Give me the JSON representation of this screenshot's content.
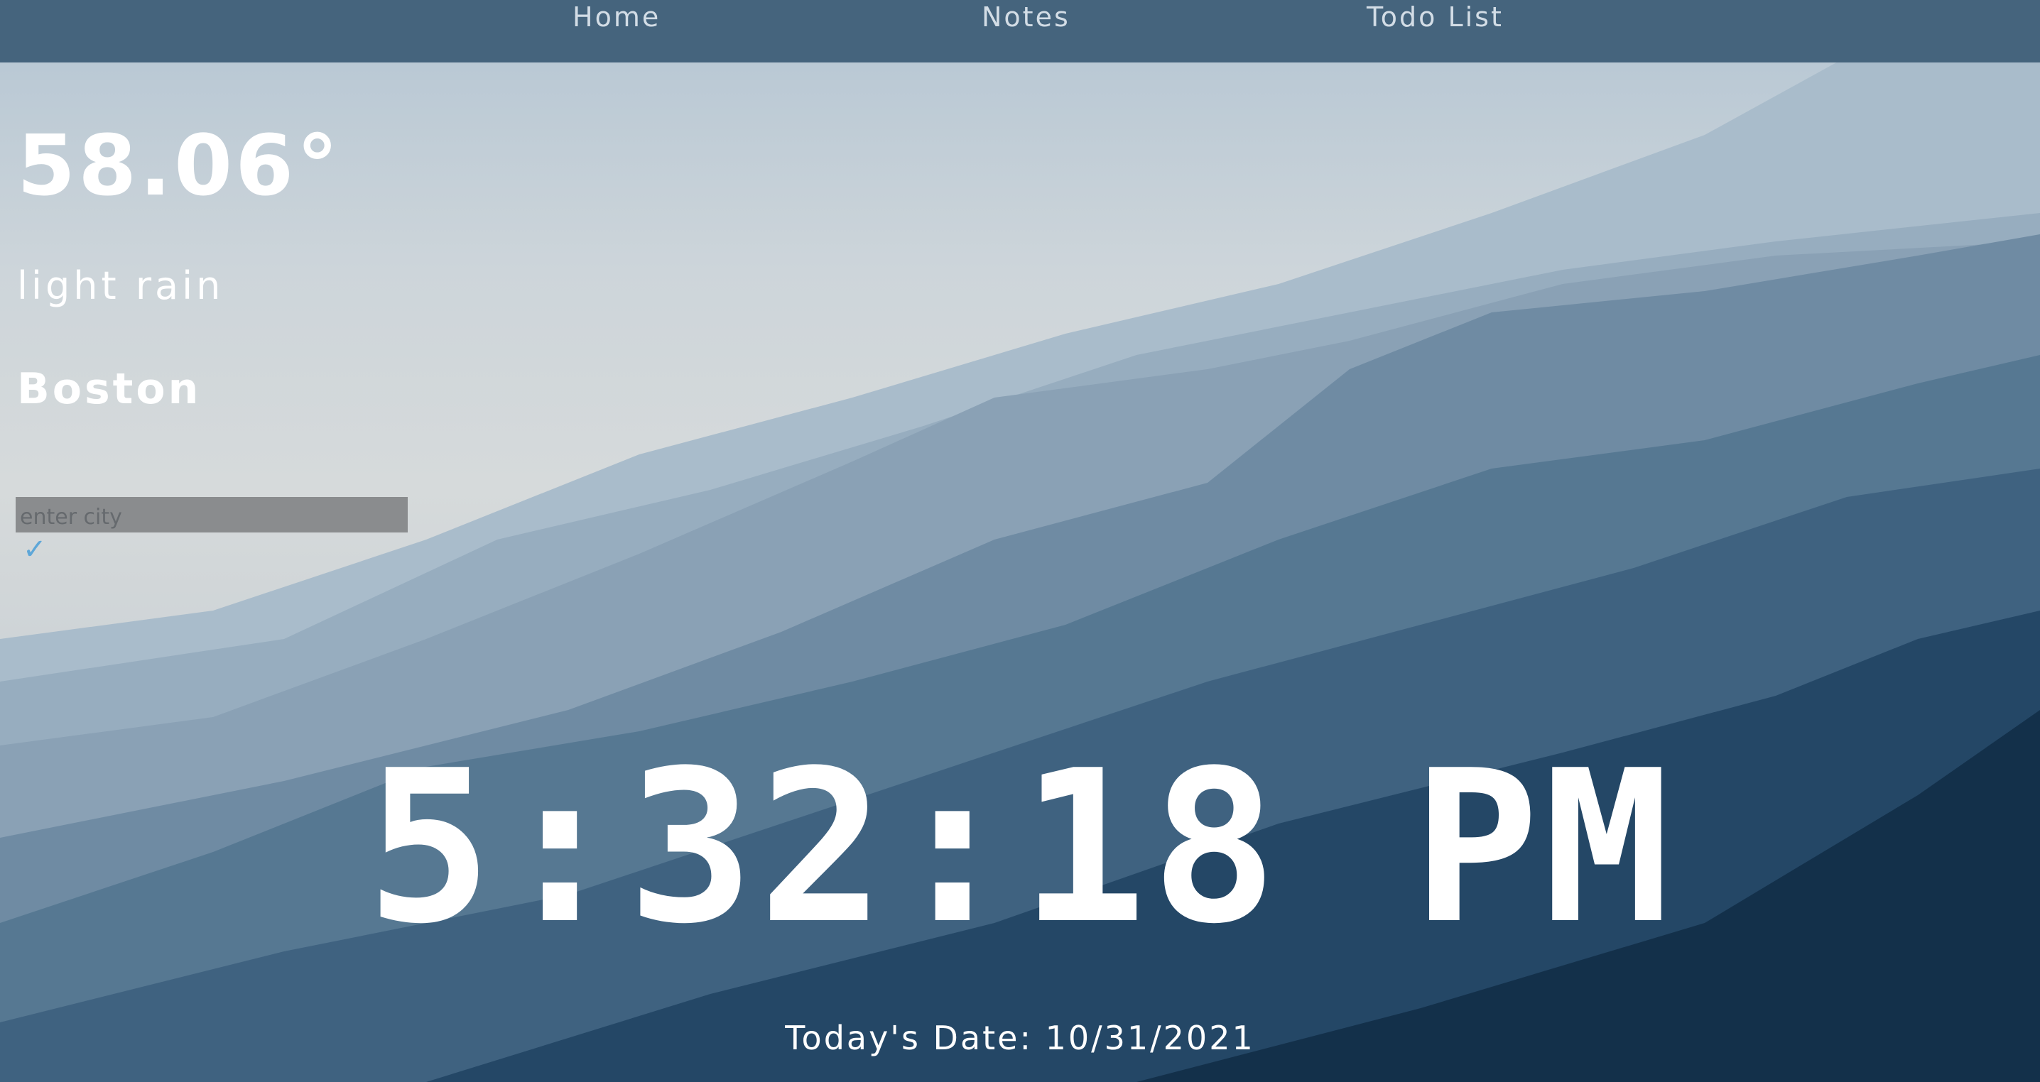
{
  "nav": {
    "home": "Home",
    "notes": "Notes",
    "todo": "Todo List"
  },
  "weather": {
    "temperature": "58.06°",
    "description": "light rain",
    "city": "Boston",
    "city_input_placeholder": "enter city",
    "submit_symbol": "✓"
  },
  "clock": {
    "time": "5:32:18 PM",
    "date": "Today's Date: 10/31/2021"
  },
  "colors": {
    "navbar": "#45647d",
    "text": "#ffffff",
    "accent": "#5ea7d8"
  }
}
